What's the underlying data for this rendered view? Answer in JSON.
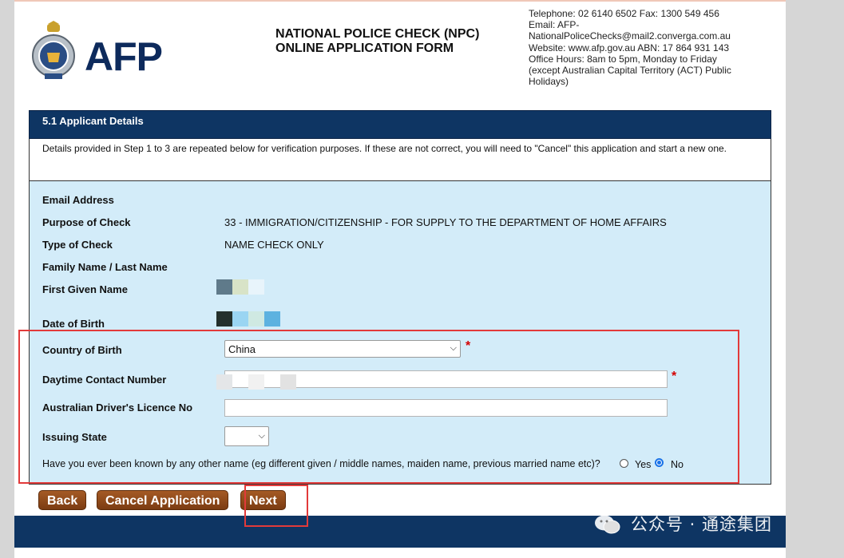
{
  "header": {
    "logo_text": "AFP",
    "form_title_line1": "NATIONAL POLICE CHECK (NPC)",
    "form_title_line2": "ONLINE APPLICATION FORM",
    "contact_lines": [
      "Telephone: 02 6140 6502  Fax: 1300 549 456",
      "Email: AFP-",
      "NationalPoliceChecks@mail2.converga.com.au",
      "Website: www.afp.gov.au    ABN: 17 864 931 143",
      "Office Hours: 8am to 5pm, Monday to Friday",
      "(except Australian Capital Territory (ACT) Public",
      "Holidays)"
    ]
  },
  "section": {
    "title": "5.1 Applicant Details",
    "info": "Details provided in Step 1 to 3 are repeated below for verification purposes. If these are not correct, you will need to \"Cancel\" this application and start a new one."
  },
  "details": {
    "email_label": "Email Address",
    "purpose_label": "Purpose of Check",
    "purpose_value": "33 - IMMIGRATION/CITIZENSHIP - FOR SUPPLY TO THE DEPARTMENT OF HOME AFFAIRS",
    "type_label": "Type of Check",
    "type_value": "NAME CHECK ONLY",
    "family_label": "Family Name / Last Name",
    "first_label": "First Given Name",
    "dob_label": "Date of Birth",
    "country_label": "Country of Birth",
    "country_value": "China",
    "phone_label": "Daytime Contact Number",
    "licence_label": "Australian Driver's Licence No",
    "state_label": "Issuing State",
    "state_value": "",
    "required_mark": "*",
    "question": "Have you ever been known by any other name (eg different given / middle names, maiden name, previous married name etc)?",
    "yes_label": "Yes",
    "no_label": "No",
    "selected_option": "No"
  },
  "buttons": {
    "back": "Back",
    "cancel": "Cancel Application",
    "next": "Next"
  },
  "watermark": "公众号 · 通途集团",
  "colors": {
    "navy": "#0e3563",
    "panel": "#d3ecf9",
    "button": "#8b4516",
    "highlight": "#e23a3a",
    "required": "#d40000"
  }
}
